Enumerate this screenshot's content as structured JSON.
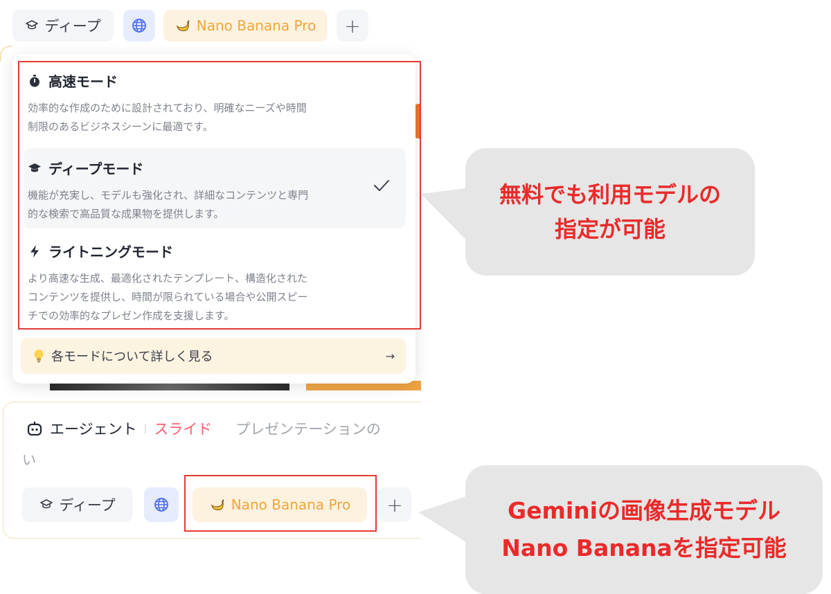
{
  "toolbar_top": {
    "deep_label": "ディープ",
    "nano_label": "Nano Banana Pro",
    "plus_label": "+"
  },
  "dropdown": {
    "modes": [
      {
        "title": "高速モード",
        "desc": "効率的な作成のために設計されており、明確なニーズや時間\n制限のあるビジネスシーンに最適です。",
        "icon": "stopwatch-icon",
        "selected": false
      },
      {
        "title": "ディープモード",
        "desc": "機能が充実し、モデルも強化され、詳細なコンテンツと専門\n的な検索で高品質な成果物を提供します。",
        "icon": "graduation-cap-icon",
        "selected": true
      },
      {
        "title": "ライトニングモード",
        "desc": "より高速な生成、最適化されたテンプレート、構造化された\nコンテンツを提供し、時間が限られている場合や公開スピー\nチでの効率的なプレゼン作成を支援します。",
        "icon": "lightning-icon",
        "selected": false
      }
    ],
    "more_link": "各モードについて詳しく見る",
    "more_arrow": "→"
  },
  "input": {
    "agent_label": "エージェント",
    "separator": "|",
    "slide_label": "スライド",
    "placeholder_line1": "プレゼンテーションの",
    "placeholder_line2": "い"
  },
  "toolbar_bottom": {
    "deep_label": "ディープ",
    "nano_label": "Nano Banana Pro",
    "plus_label": "+"
  },
  "callouts": {
    "top": "無料でも利用モデルの\n指定が可能",
    "bottom": "Geminiの画像生成モデル\nNano Bananaを指定可能"
  },
  "colors": {
    "accent_red": "#e53935",
    "callout_text": "#ea2a2a",
    "nano_text": "#f0a63a",
    "slide_pink": "#ff5b6e"
  }
}
